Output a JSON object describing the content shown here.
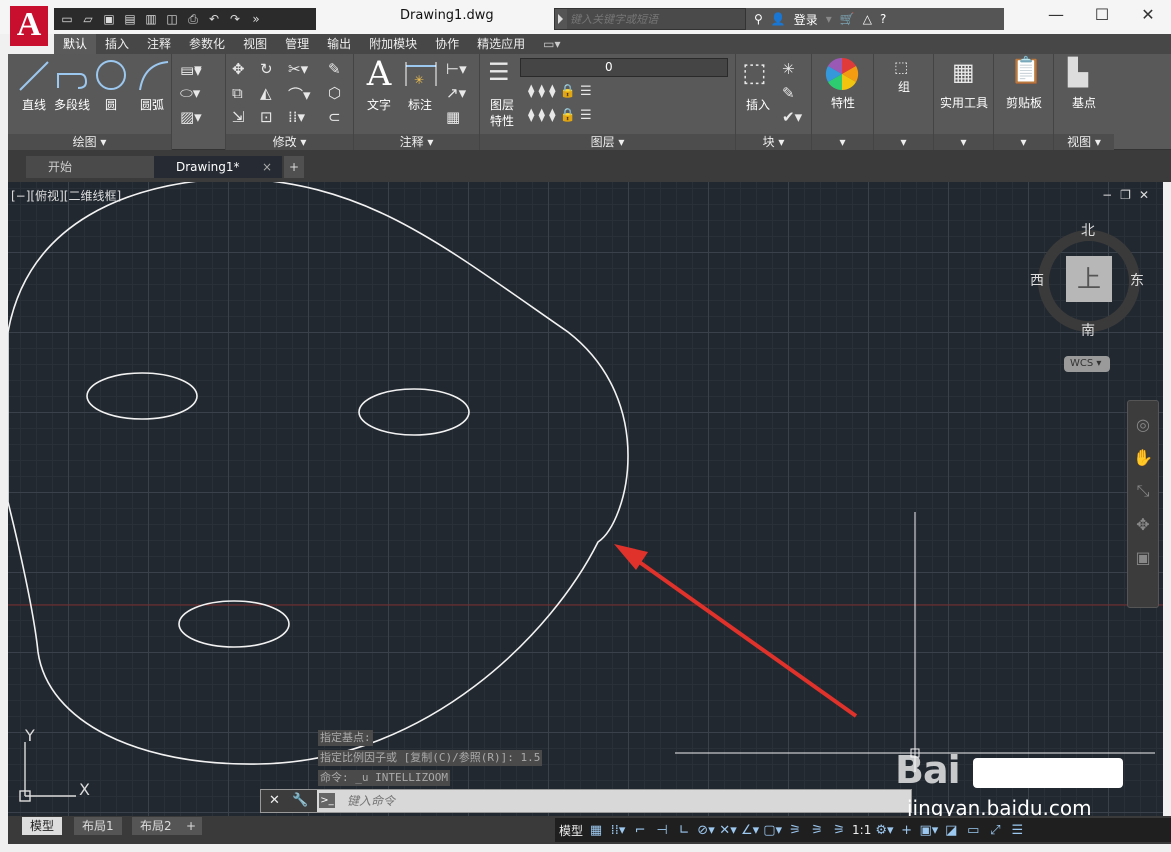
{
  "app": {
    "logo_letter": "A",
    "doc_title": "Drawing1.dwg",
    "search_placeholder": "键入关键字或短语",
    "login_label": "登录",
    "help_label": "?"
  },
  "qat_icons": [
    "new-icon",
    "open-icon",
    "save-icon",
    "saveas-icon",
    "publish-icon",
    "share-icon",
    "print-icon",
    "undo-icon",
    "redo-icon",
    "more-icon"
  ],
  "window": {
    "minimize": "—",
    "maximize": "☐",
    "close": "✕"
  },
  "ribbon_tabs": [
    {
      "label": "默认",
      "active": true
    },
    {
      "label": "插入"
    },
    {
      "label": "注释"
    },
    {
      "label": "参数化"
    },
    {
      "label": "视图"
    },
    {
      "label": "管理"
    },
    {
      "label": "输出"
    },
    {
      "label": "附加模块"
    },
    {
      "label": "协作"
    },
    {
      "label": "精选应用"
    }
  ],
  "panels": {
    "draw": {
      "footer": "绘图 ▾",
      "tools": [
        "直线",
        "多段线",
        "圆",
        "圆弧"
      ]
    },
    "modify": {
      "footer": "修改 ▾"
    },
    "annotate": {
      "footer": "注释 ▾",
      "tools": [
        "文字",
        "标注"
      ]
    },
    "layers": {
      "footer": "图层 ▾",
      "tool_line1": "图层",
      "tool_line2": "特性",
      "current_layer": "0"
    },
    "block": {
      "footer": "块 ▾",
      "tool": "插入"
    },
    "properties": {
      "tool": "特性"
    },
    "groups": {
      "tool": "组"
    },
    "utilities": {
      "tool": "实用工具"
    },
    "clipboard": {
      "tool": "剪贴板"
    },
    "view": {
      "footer": "视图 ▾",
      "tool": "基点"
    }
  },
  "doc_tabs": {
    "start": "开始",
    "current": "Drawing1*",
    "close": "×",
    "add": "+"
  },
  "viewport": {
    "label": "[−][俯视][二维线框]",
    "controls": [
      "−",
      "❐",
      "✕"
    ]
  },
  "viewcube": {
    "north": "北",
    "south": "南",
    "east": "东",
    "west": "西",
    "face": "上",
    "wcs": "WCS ▾"
  },
  "ucs": {
    "x": "X",
    "y": "Y"
  },
  "command": {
    "history": [
      "指定基点:",
      "指定比例因子或 [复制(C)/参照(R)]: 1.5",
      "命令: _u INTELLIZOOM"
    ],
    "input_placeholder": "键入命令"
  },
  "layout_tabs": [
    "模型",
    "布局1",
    "布局2",
    "+"
  ],
  "status": {
    "model_label": "模型",
    "scale": "1:1"
  },
  "watermark": {
    "brand": "Bai",
    "url": "jingyan.baidu.com"
  },
  "colors": {
    "canvas_bg": "#212830",
    "annotation_arrow": "#e0322a",
    "logo_red": "#c8102e"
  }
}
